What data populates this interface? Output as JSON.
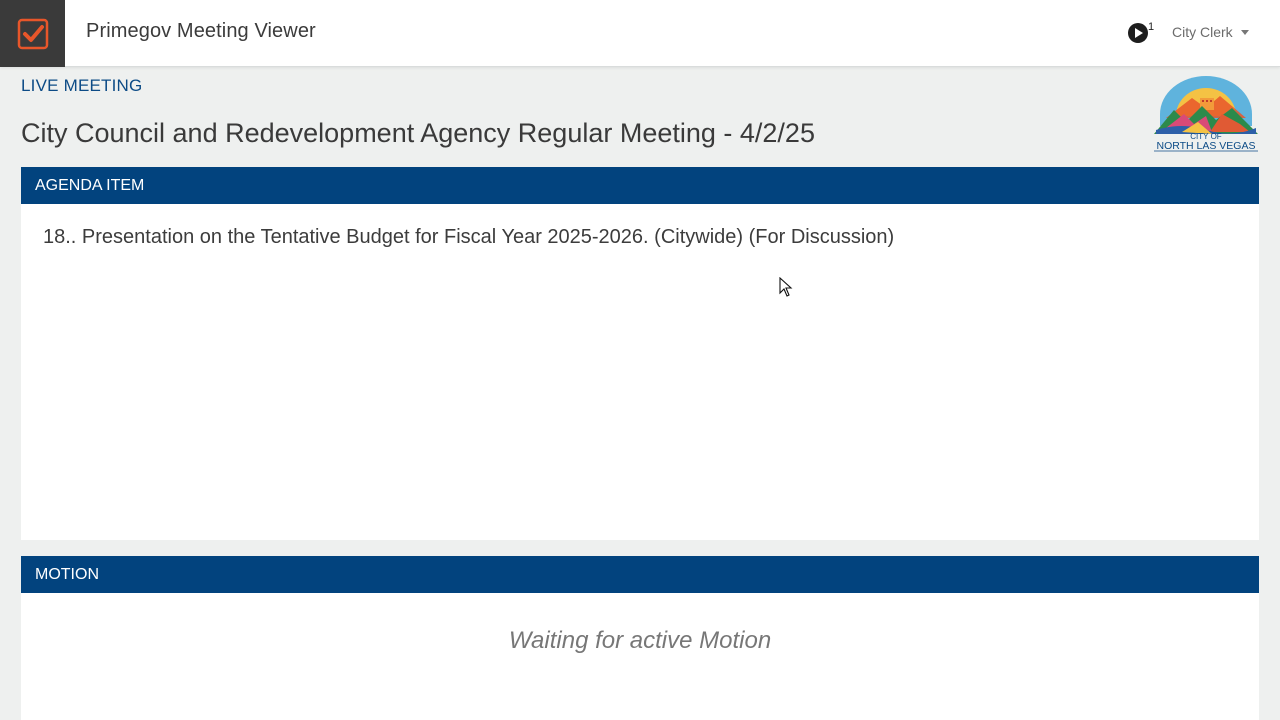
{
  "app": {
    "title": "Primegov Meeting Viewer",
    "logo_icon": "checkbox-checked-icon"
  },
  "header": {
    "live_indicator": {
      "icon": "play-circle-icon",
      "count": "1"
    },
    "user_menu": {
      "label": "City Clerk",
      "icon": "caret-down-icon"
    }
  },
  "meeting": {
    "status": "LIVE MEETING",
    "title": "City Council and Redevelopment Agency Regular Meeting - 4/2/25",
    "seal": {
      "line1": "CITY OF",
      "line2": "NORTH LAS VEGAS"
    }
  },
  "agenda": {
    "header": "AGENDA ITEM",
    "item_text": "18.. Presentation on the Tentative Budget for Fiscal Year 2025-2026. (Citywide) (For Discussion)"
  },
  "motion": {
    "header": "MOTION",
    "waiting_text": "Waiting for active Motion"
  },
  "colors": {
    "header_blue": "#02437e",
    "accent_orange": "#e8562a",
    "page_bg": "#eef0ef"
  }
}
